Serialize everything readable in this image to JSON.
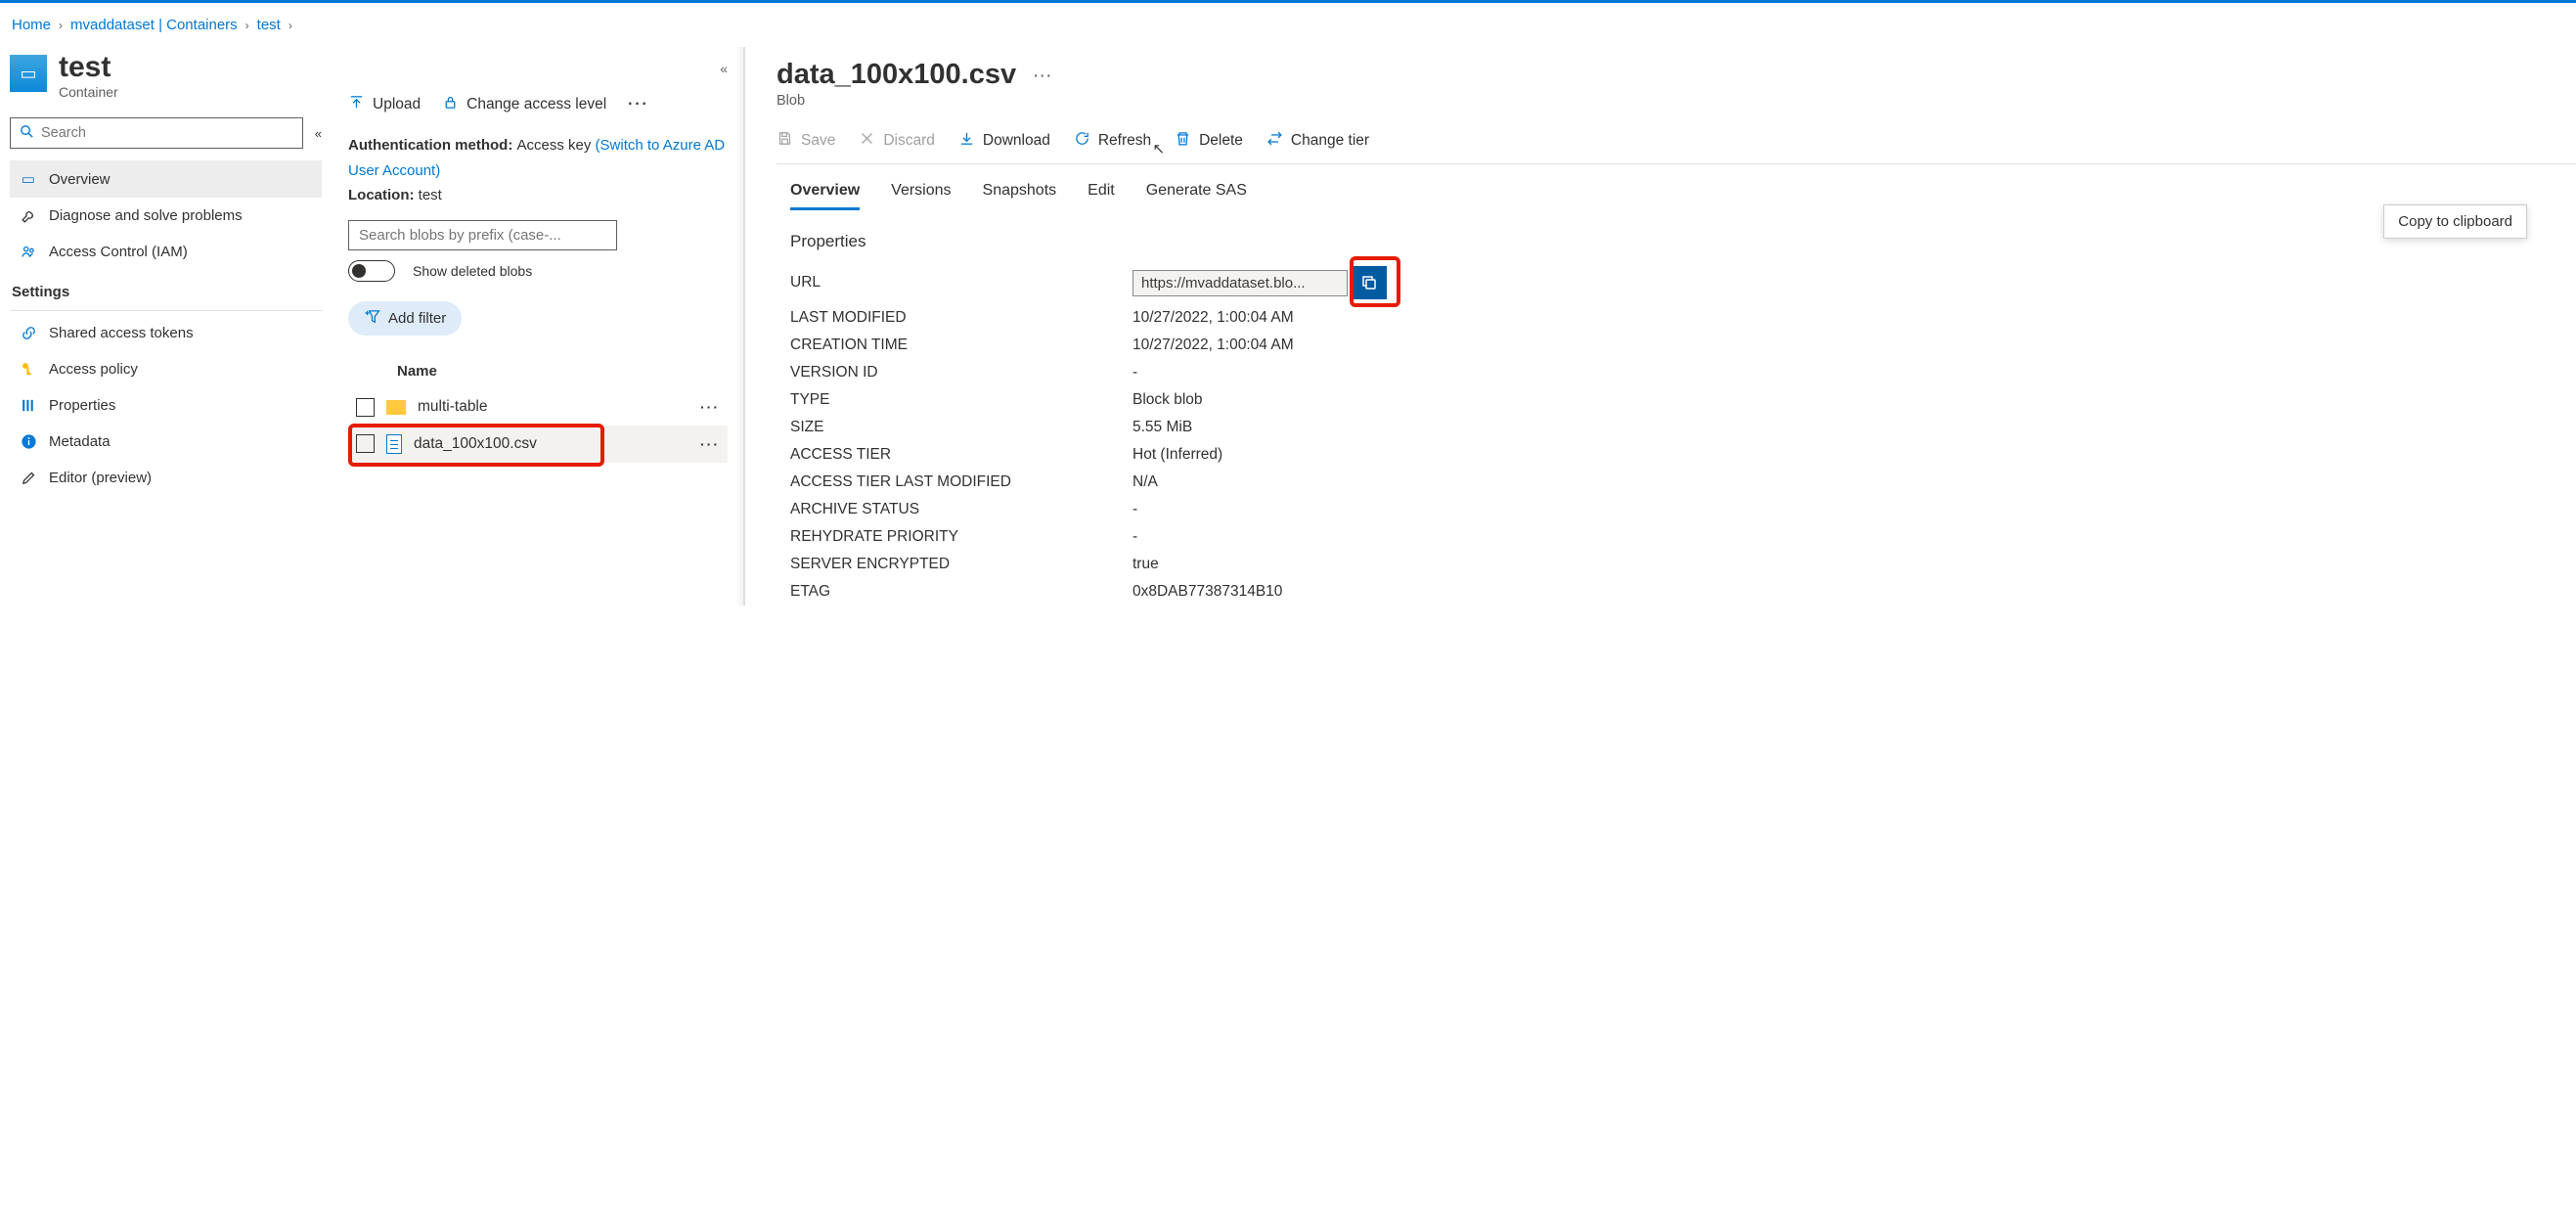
{
  "breadcrumb": {
    "home": "Home",
    "storage": "mvaddataset | Containers",
    "container": "test"
  },
  "container": {
    "title": "test",
    "subtitle": "Container"
  },
  "sidebar": {
    "search_placeholder": "Search",
    "items": [
      {
        "label": "Overview"
      },
      {
        "label": "Diagnose and solve problems"
      },
      {
        "label": "Access Control (IAM)"
      }
    ],
    "settings_header": "Settings",
    "settings": [
      {
        "label": "Shared access tokens"
      },
      {
        "label": "Access policy"
      },
      {
        "label": "Properties"
      },
      {
        "label": "Metadata"
      },
      {
        "label": "Editor (preview)"
      }
    ]
  },
  "mid_toolbar": {
    "upload": "Upload",
    "change_access": "Change access level"
  },
  "auth": {
    "method_label": "Authentication method:",
    "method_value": "Access key",
    "switch_link": "(Switch to Azure AD User Account)",
    "location_label": "Location:",
    "location_value": "test"
  },
  "blob_search_placeholder": "Search blobs by prefix (case-...",
  "show_deleted": "Show deleted blobs",
  "add_filter": "Add filter",
  "list": {
    "name_header": "Name",
    "items": [
      {
        "name": "multi-table",
        "type": "folder"
      },
      {
        "name": "data_100x100.csv",
        "type": "file"
      }
    ]
  },
  "blob": {
    "title": "data_100x100.csv",
    "subtitle": "Blob"
  },
  "blob_toolbar": {
    "save": "Save",
    "discard": "Discard",
    "download": "Download",
    "refresh": "Refresh",
    "delete": "Delete",
    "change_tier": "Change tier"
  },
  "tabs": [
    "Overview",
    "Versions",
    "Snapshots",
    "Edit",
    "Generate SAS"
  ],
  "tooltip": "Copy to clipboard",
  "props_header": "Properties",
  "properties": {
    "url_label": "URL",
    "url_value": "https://mvaddataset.blo...",
    "last_modified_label": "LAST MODIFIED",
    "last_modified_value": "10/27/2022, 1:00:04 AM",
    "creation_time_label": "CREATION TIME",
    "creation_time_value": "10/27/2022, 1:00:04 AM",
    "version_id_label": "VERSION ID",
    "version_id_value": "-",
    "type_label": "TYPE",
    "type_value": "Block blob",
    "size_label": "SIZE",
    "size_value": "5.55 MiB",
    "access_tier_label": "ACCESS TIER",
    "access_tier_value": "Hot (Inferred)",
    "access_tier_lm_label": "ACCESS TIER LAST MODIFIED",
    "access_tier_lm_value": "N/A",
    "archive_status_label": "ARCHIVE STATUS",
    "archive_status_value": "-",
    "rehydrate_label": "REHYDRATE PRIORITY",
    "rehydrate_value": "-",
    "server_encrypted_label": "SERVER ENCRYPTED",
    "server_encrypted_value": "true",
    "etag_label": "ETAG",
    "etag_value": "0x8DAB77387314B10"
  }
}
